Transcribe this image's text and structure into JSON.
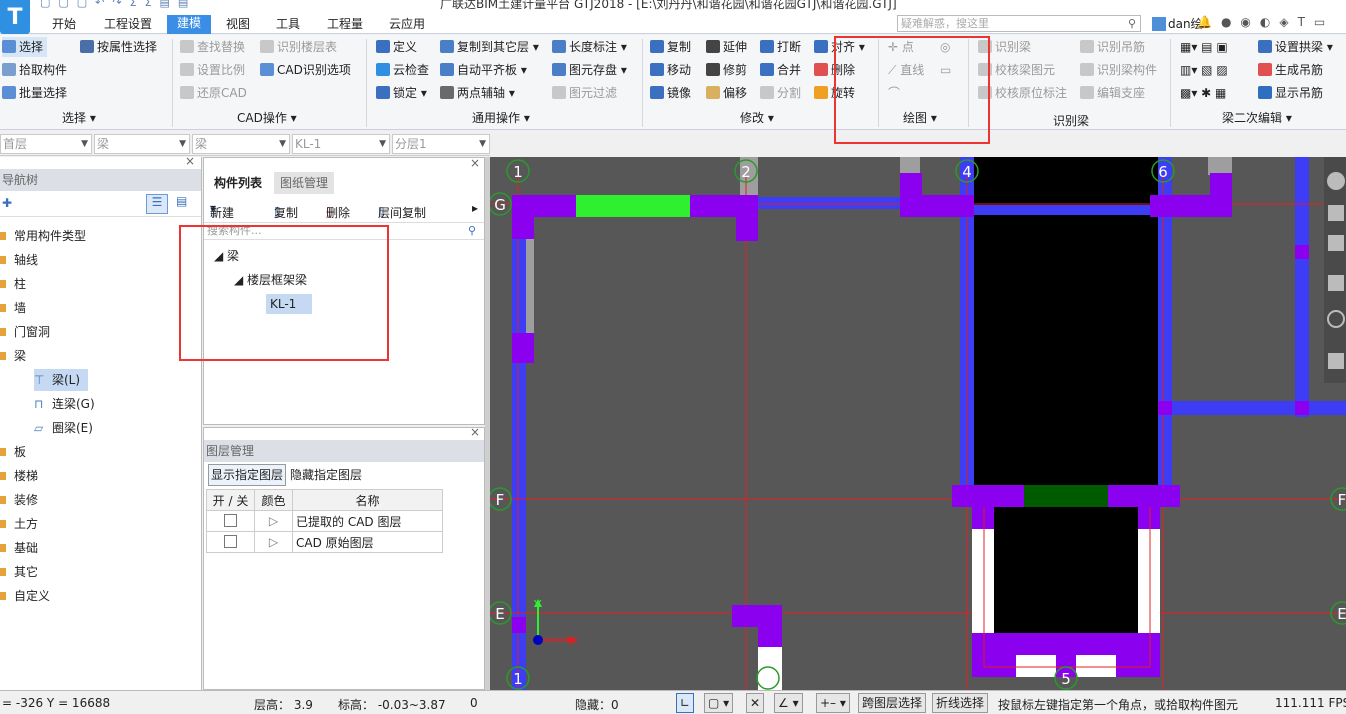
{
  "title_bar": {
    "title": "广联达BIM土建计量平台 GTJ2018 - [E:\\刘丹丹\\和谐花园\\和谐花园GTJ\\和谐花园.GTJ]"
  },
  "menu": {
    "tabs": [
      "开始",
      "工程设置",
      "建模",
      "视图",
      "工具",
      "工程量",
      "云应用"
    ],
    "active_tab": "建模",
    "search_placeholder": "疑难解惑，搜这里",
    "user": "dan绘"
  },
  "ribbon": {
    "select_group": {
      "select": "选择",
      "pick": "拾取构件",
      "batch": "批量选择",
      "by_attr": "按属性选择",
      "label": "选择"
    },
    "cad_group": {
      "find_replace": "查找替换",
      "set_scale": "设置比例",
      "restore_cad": "还原CAD",
      "recog_floor": "识别楼层表",
      "cad_options": "CAD识别选项",
      "label": "CAD操作"
    },
    "common_group": {
      "define": "定义",
      "cloud_check": "云检查",
      "lock": "锁定",
      "copy_to_floor": "复制到其它层",
      "auto_flush": "自动平齐板",
      "two_point_axis": "两点辅轴",
      "length_mark": "长度标注",
      "save_element": "图元存盘",
      "element_filter": "图元过滤",
      "label": "通用操作"
    },
    "modify_group": {
      "copy": "复制",
      "move": "移动",
      "mirror": "镜像",
      "extend": "延伸",
      "trim": "修剪",
      "offset": "偏移",
      "break": "打断",
      "merge": "合并",
      "split": "分割",
      "align": "对齐",
      "delete": "删除",
      "rotate": "旋转",
      "label": "修改"
    },
    "draw_group": {
      "point": "点",
      "line": "直线",
      "label": "绘图"
    },
    "recog_beam_group": {
      "recog_beam": "识别梁",
      "check_beam": "校核梁图元",
      "check_original": "校核原位标注",
      "recog_hanger": "识别吊筋",
      "recog_beam_elem": "识别梁构件",
      "edit_support": "编辑支座",
      "label": "识别梁"
    },
    "beam_edit_group": {
      "set_arch_beam": "设置拱梁",
      "gen_hanger": "生成吊筋",
      "show_hanger": "显示吊筋",
      "label": "梁二次编辑"
    }
  },
  "prop_bar": {
    "floor": "首层",
    "category": "梁",
    "subcat": "梁",
    "component": "KL-1",
    "layer": "分层1"
  },
  "nav_tree": {
    "title": "导航树",
    "items": [
      "常用构件类型",
      "轴线",
      "柱",
      "墙",
      "门窗洞",
      "梁",
      "板",
      "楼梯",
      "装修",
      "土方",
      "基础",
      "其它",
      "自定义"
    ],
    "sub_items": [
      "梁(L)",
      "连梁(G)",
      "圈梁(E)"
    ]
  },
  "component_list": {
    "tabs": [
      "构件列表",
      "图纸管理"
    ],
    "toolbar": {
      "new": "新建",
      "copy": "复制",
      "delete": "删除",
      "floor_copy": "层间复制"
    },
    "search_placeholder": "搜索构件...",
    "tree": {
      "root": "梁",
      "group": "楼层框架梁",
      "item": "KL-1"
    }
  },
  "layer_panel": {
    "title": "图层管理",
    "show_btn": "显示指定图层",
    "hide_btn": "隐藏指定图层",
    "headers": [
      "开 / 关",
      "颜色",
      "名称"
    ],
    "rows": [
      {
        "name": "已提取的 CAD 图层"
      },
      {
        "name": "CAD 原始图层"
      }
    ]
  },
  "canvas": {
    "axis_top": [
      "1",
      "2",
      "4",
      "6"
    ],
    "axis_left": [
      "G",
      "F",
      "E"
    ],
    "axis_bottom": [
      "1",
      "5"
    ],
    "axis_right": [
      "F",
      "E"
    ],
    "coord_x": "X",
    "coord_y": "Y"
  },
  "status": {
    "coords": "= -326 Y = 16688",
    "floor_height": "层高：  3.9",
    "elevation": "标高：  -0.03~3.87",
    "zero": "0",
    "hidden": "隐藏：0",
    "cross_layer": "跨图层选择",
    "polyline_select": "折线选择",
    "hint": "按鼠标左键指定第一个角点，或拾取构件图元",
    "fps": "111.111 FPS"
  }
}
